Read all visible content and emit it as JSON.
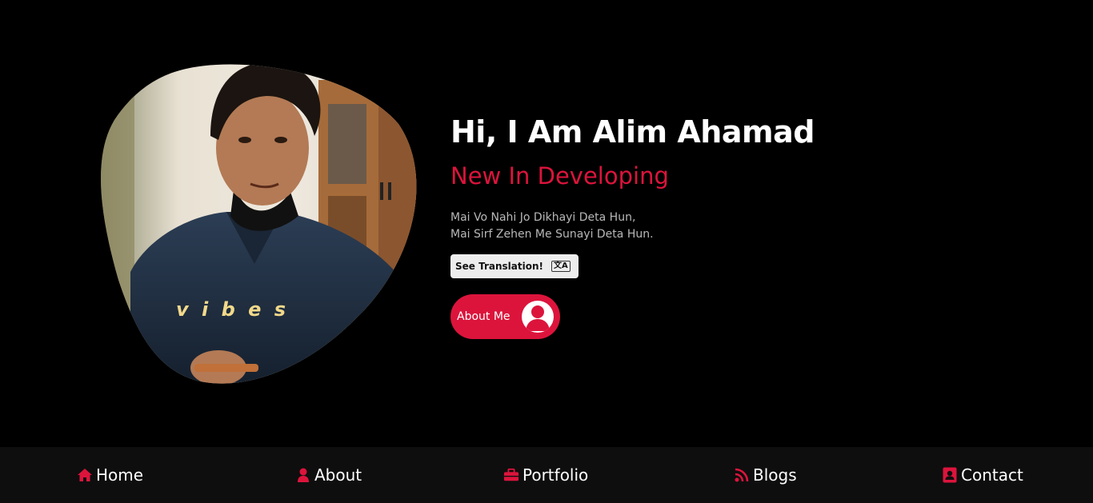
{
  "hero": {
    "greeting": "Hi, I Am Alim Ahamad",
    "subtitle": "New In Developing",
    "quote_line1": "Mai Vo Nahi Jo Dikhayi Deta Hun,",
    "quote_line2": "Mai Sirf Zehen Me Sunayi Deta Hun.",
    "translate_label": "See Translation!",
    "about_label": "About Me"
  },
  "photo": {
    "overlay_text": "v i b e s"
  },
  "nav": {
    "items": [
      {
        "label": "Home",
        "icon": "home-icon"
      },
      {
        "label": "About",
        "icon": "user-icon"
      },
      {
        "label": "Portfolio",
        "icon": "briefcase-icon"
      },
      {
        "label": "Blogs",
        "icon": "rss-icon"
      },
      {
        "label": "Contact",
        "icon": "contact-icon"
      }
    ]
  },
  "colors": {
    "accent": "#dc143c",
    "background": "#000000",
    "nav_background": "#0e0e0e"
  }
}
